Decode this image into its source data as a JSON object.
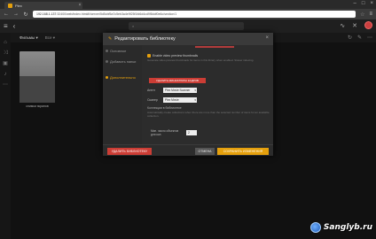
{
  "browser": {
    "tab_title": "Plex",
    "url_host": "192.168.1.137",
    "url_path": ":32400/web/index.html#!/server/5d5cbf5a7c5eb3a4e9f25f1fd6d4cd9f8ddf0e6c/section/1",
    "star_icon": "star-icon",
    "menu_icon": "menu-icon"
  },
  "app": {
    "search_placeholder": "",
    "lib_filter": "Фильмы ▾",
    "lib_filter2": "Все ▾"
  },
  "poster": {
    "label": "снимки экранов"
  },
  "modal": {
    "title": "Редактировать библиотеку",
    "side_items": [
      {
        "label": "Основное"
      },
      {
        "label": "Добавить папки"
      },
      {
        "label": "Дополнительно"
      }
    ],
    "checkbox_label": "Enable video preview thumbnails",
    "help1": "Generate video preview thumbnails for items in this library when enabled. Slower indexing.",
    "red_button_label": "УДАЛИТЬ МИНИАТЮРЫ КАДРОВ",
    "agent_label": "Агент",
    "agent_value": "Plex Movie Scanner",
    "scanner_label": "Сканер",
    "scanner_value": "Plex Movie",
    "collections_label": "Коллекции в библиотеке",
    "help2": "Automatically create collections when there are more than the selected number of items for an available collection.",
    "min_label": "Мин. число объектов для кол.",
    "min_value": "2",
    "delete_button": "УДАЛИТЬ БИБЛИОТЕКУ",
    "cancel_button": "ОТМЕНА",
    "save_button": "СОХРАНИТЬ ИЗМЕНЕНИЯ"
  },
  "watermark": {
    "text": "Sanglyb.ru"
  },
  "colors": {
    "accent": "#e5a00d",
    "danger": "#cc3d35"
  }
}
